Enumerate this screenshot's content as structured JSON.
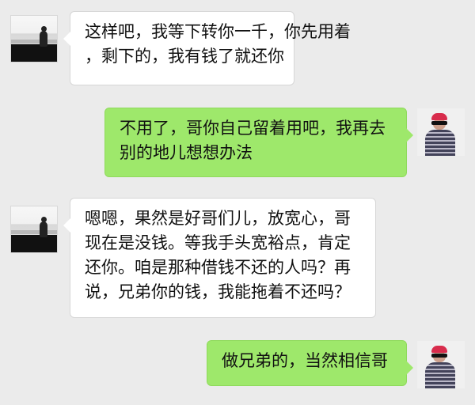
{
  "messages": [
    {
      "side": "left",
      "avatar_icon": "seaside-silhouette-avatar-icon",
      "lines": [
        "这样吧，我等下转你一千，你先用着",
        "，剩下的，我有钱了就还你"
      ]
    },
    {
      "side": "right",
      "avatar_icon": "red-hat-sunglasses-avatar-icon",
      "lines": [
        "不用了，哥你自己留着用吧，我再去",
        "别的地儿想想办法"
      ]
    },
    {
      "side": "left",
      "avatar_icon": "seaside-silhouette-avatar-icon",
      "lines": [
        "嗯嗯，果然是好哥们儿，放宽心，哥",
        "现在是没钱。等我手头宽裕点，肯定",
        "还你。咱是那种借钱不还的人吗？再",
        "说，兄弟你的钱，我能拖着不还吗？"
      ]
    },
    {
      "side": "right",
      "avatar_icon": "red-hat-sunglasses-avatar-icon",
      "lines": [
        "做兄弟的，当然相信哥"
      ]
    }
  ],
  "colors": {
    "background": "#ebebeb",
    "incoming_bubble": "#ffffff",
    "outgoing_bubble": "#9ee86b",
    "text": "#111111"
  }
}
